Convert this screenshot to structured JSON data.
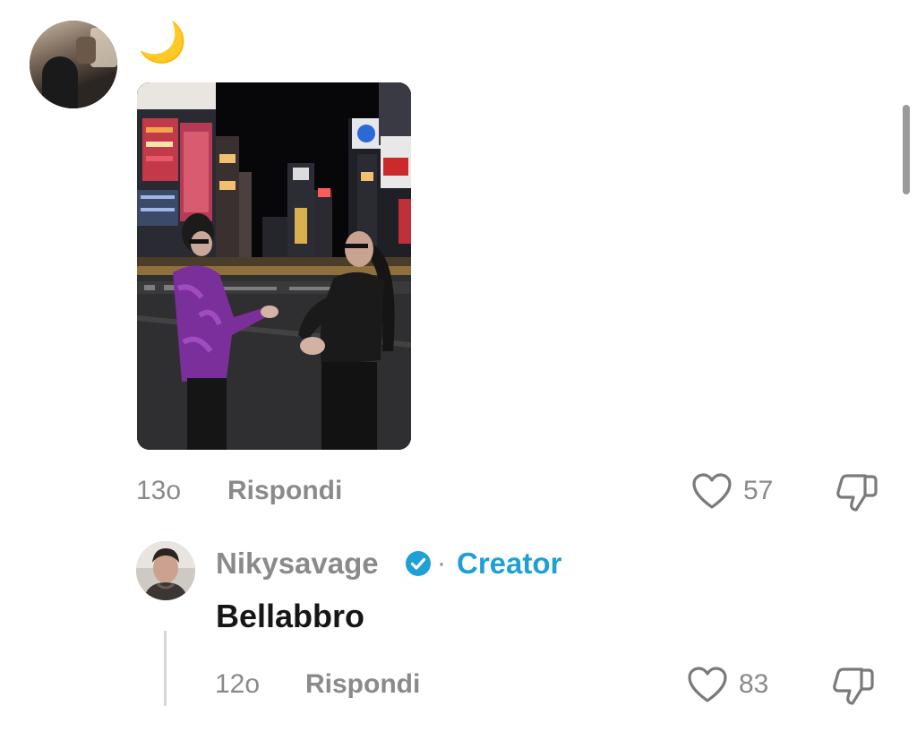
{
  "comment": {
    "emoji": "🌙",
    "timestamp": "13o",
    "reply_label": "Rispondi",
    "likes": "57"
  },
  "reply": {
    "username": "Nikysavage",
    "separator": "·",
    "creator_label": "Creator",
    "text": "Bellabbro",
    "timestamp": "12o",
    "reply_label": "Rispondi",
    "likes": "83"
  },
  "icons": {
    "like": "heart-icon",
    "dislike": "thumbs-down-icon",
    "verified": "verified-badge-icon"
  },
  "colors": {
    "accent": "#1ea0d6",
    "muted_text": "#8a8a8a",
    "primary_text": "#161616",
    "moon": "#f3c23a"
  }
}
